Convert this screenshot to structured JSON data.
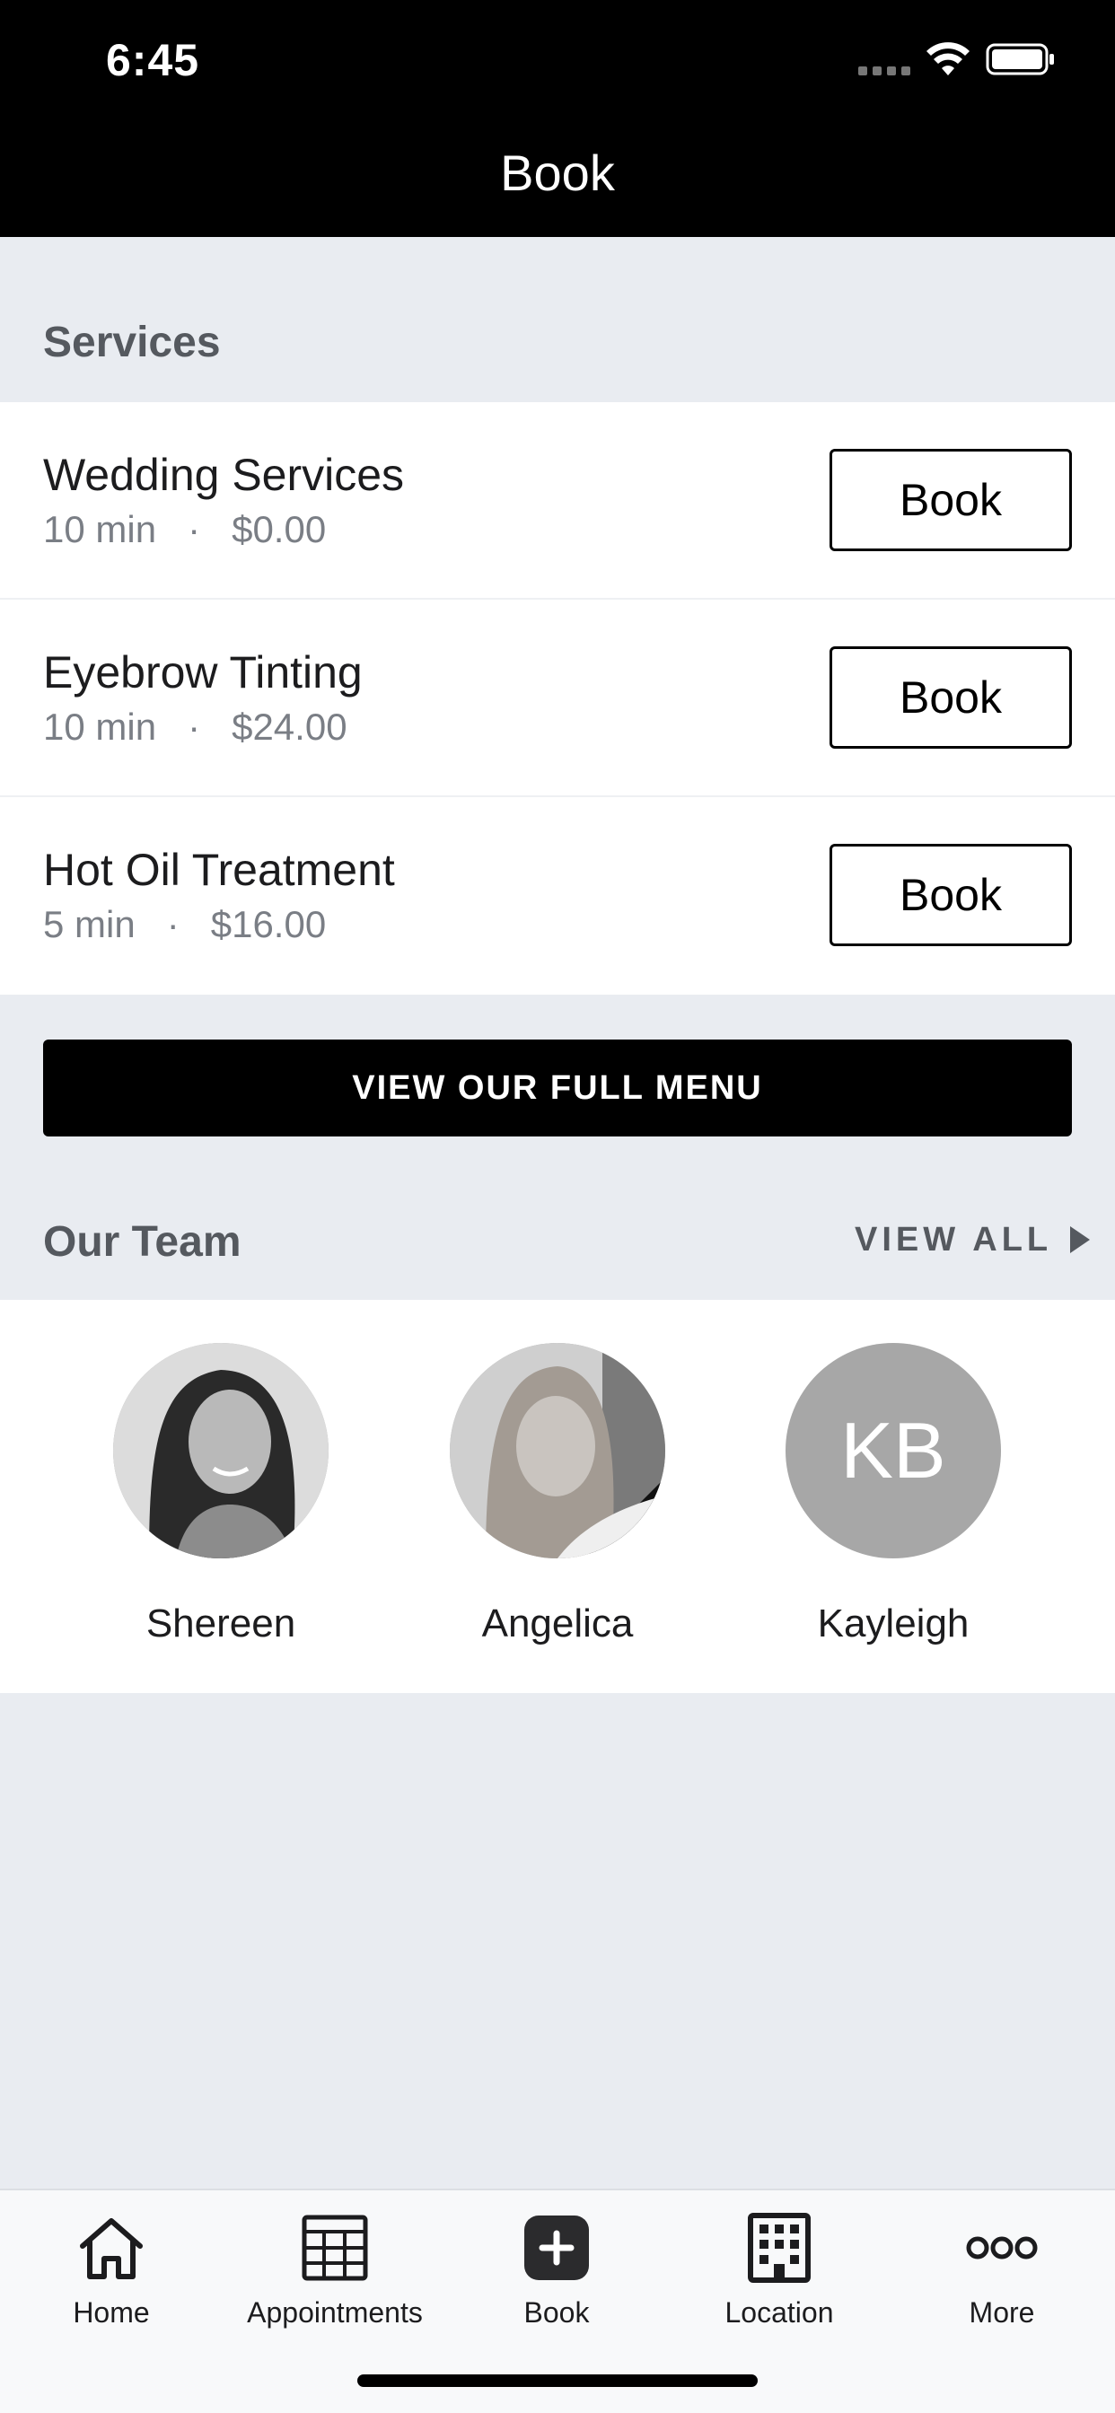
{
  "status_bar": {
    "time": "6:45"
  },
  "header": {
    "title": "Book"
  },
  "services": {
    "title": "Services",
    "items": [
      {
        "name": "Wedding Services",
        "duration": "10 min",
        "price": "$0.00",
        "button": "Book"
      },
      {
        "name": "Eyebrow Tinting",
        "duration": "10 min",
        "price": "$24.00",
        "button": "Book"
      },
      {
        "name": "Hot Oil Treatment",
        "duration": "5 min",
        "price": "$16.00",
        "button": "Book"
      }
    ],
    "separator": "·",
    "full_menu_button": "VIEW OUR FULL MENU"
  },
  "team": {
    "title": "Our Team",
    "view_all": "VIEW ALL",
    "members": [
      {
        "name": "Shereen",
        "avatar": "photo"
      },
      {
        "name": "Angelica",
        "avatar": "photo"
      },
      {
        "name": "Kayleigh",
        "avatar": "initials",
        "initials": "KB"
      }
    ]
  },
  "tabbar": {
    "items": [
      {
        "label": "Home",
        "icon": "home-icon"
      },
      {
        "label": "Appointments",
        "icon": "calendar-grid-icon"
      },
      {
        "label": "Book",
        "icon": "plus-square-icon"
      },
      {
        "label": "Location",
        "icon": "building-icon"
      },
      {
        "label": "More",
        "icon": "more-dots-icon"
      }
    ]
  },
  "colors": {
    "header_bg": "#000000",
    "page_bg": "#e9ecf1",
    "section_title": "#55595f",
    "accent": "#000000"
  }
}
